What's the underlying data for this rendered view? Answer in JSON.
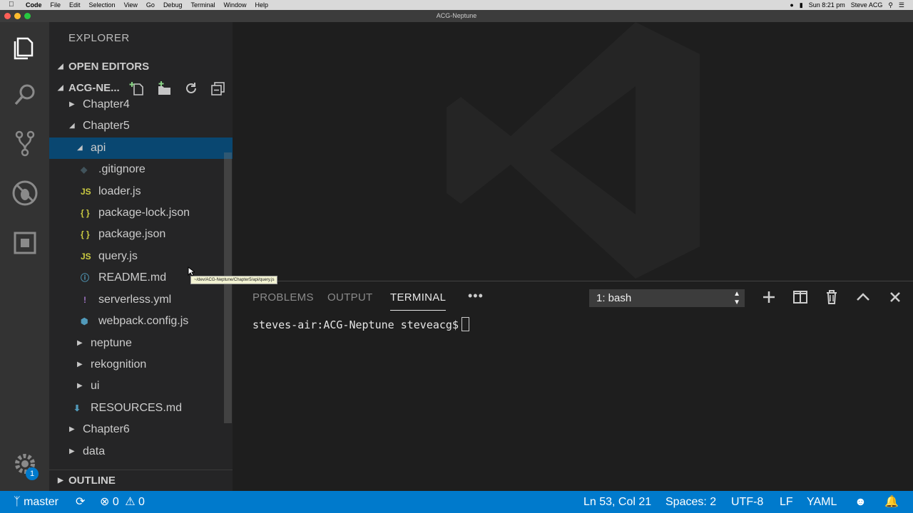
{
  "menubar": {
    "app": "Code",
    "items": [
      "File",
      "Edit",
      "Selection",
      "View",
      "Go",
      "Debug",
      "Terminal",
      "Window",
      "Help"
    ],
    "clock": "Sun 8:21 pm",
    "user": "Steve ACG"
  },
  "window": {
    "title": "ACG-Neptune"
  },
  "activity": {
    "icons": [
      "files-icon",
      "search-icon",
      "source-control-icon",
      "debug-icon",
      "extensions-icon",
      "gear-icon"
    ],
    "badge": "1"
  },
  "sidebar": {
    "title": "EXPLORER",
    "open_editors": "OPEN EDITORS",
    "folder": "ACG-NE...",
    "outline": "OUTLINE",
    "tree": [
      {
        "label": "Chapter4",
        "indent": 1,
        "type": "folder-closed"
      },
      {
        "label": "Chapter5",
        "indent": 1,
        "type": "folder-open"
      },
      {
        "label": "api",
        "indent": 2,
        "type": "folder-open",
        "selected": true
      },
      {
        "label": ".gitignore",
        "indent": 3,
        "type": "git"
      },
      {
        "label": "loader.js",
        "indent": 3,
        "type": "js"
      },
      {
        "label": "package-lock.json",
        "indent": 3,
        "type": "json"
      },
      {
        "label": "package.json",
        "indent": 3,
        "type": "json"
      },
      {
        "label": "query.js",
        "indent": 3,
        "type": "js"
      },
      {
        "label": "README.md",
        "indent": 3,
        "type": "info"
      },
      {
        "label": "serverless.yml",
        "indent": 3,
        "type": "yml"
      },
      {
        "label": "webpack.config.js",
        "indent": 3,
        "type": "webpack"
      },
      {
        "label": "neptune",
        "indent": 2,
        "type": "folder-closed"
      },
      {
        "label": "rekognition",
        "indent": 2,
        "type": "folder-closed"
      },
      {
        "label": "ui",
        "indent": 2,
        "type": "folder-closed"
      },
      {
        "label": "RESOURCES.md",
        "indent": 2,
        "type": "md"
      },
      {
        "label": "Chapter6",
        "indent": 1,
        "type": "folder-closed"
      },
      {
        "label": "data",
        "indent": 1,
        "type": "folder-closed"
      }
    ]
  },
  "tooltip": {
    "text": "~/dev/ACG-Neptune/Chapter5/api/query.js"
  },
  "panel": {
    "tabs": [
      "PROBLEMS",
      "OUTPUT",
      "TERMINAL"
    ],
    "active_tab": "TERMINAL",
    "terminal_select": "1: bash",
    "prompt": "steves-air:ACG-Neptune steveacg$"
  },
  "status": {
    "branch": "master",
    "errors": "0",
    "warnings": "0",
    "position": "Ln 53, Col 21",
    "spaces": "Spaces: 2",
    "encoding": "UTF-8",
    "eol": "LF",
    "language": "YAML"
  },
  "colors": {
    "accent": "#007acc",
    "selection": "#094771",
    "js": "#cbcb41",
    "json": "#cbcb41",
    "info": "#519aba",
    "yml": "#a074c4",
    "webpack": "#519aba",
    "md": "#519aba"
  }
}
